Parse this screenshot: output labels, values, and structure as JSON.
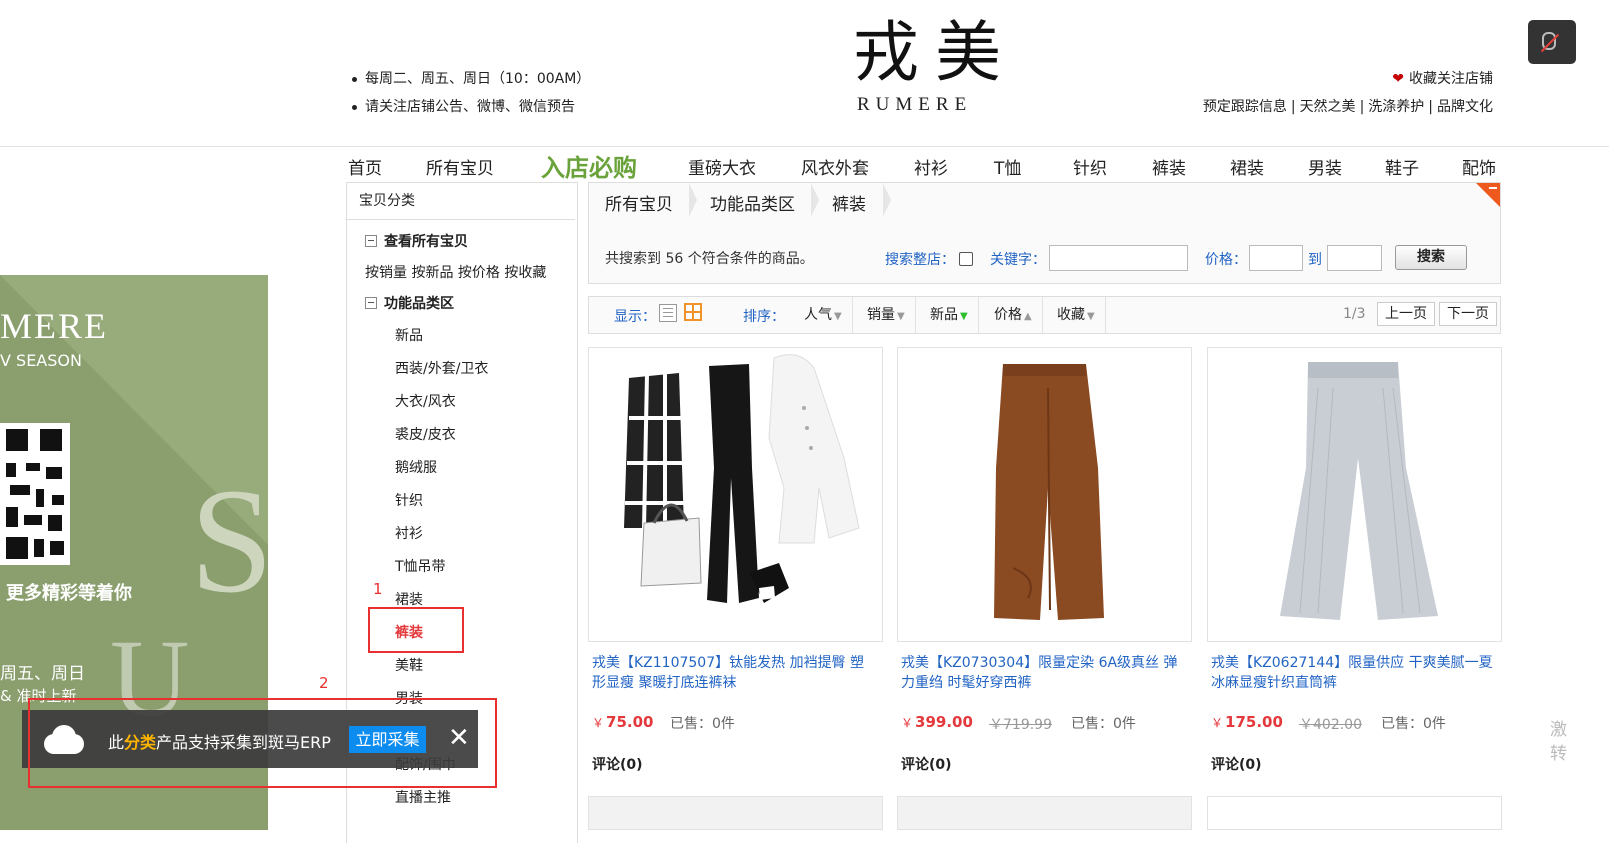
{
  "header": {
    "logo_cn": "戎美",
    "logo_en": "RUMERE",
    "notices": [
      "每周二、周五、周日（10：00AM）",
      "请关注店铺公告、微博、微信预告"
    ],
    "favorite": "收藏关注店铺",
    "links": [
      "预定跟踪信息",
      "天然之美",
      "洗涤养护",
      "品牌文化"
    ],
    "link_separator": "|"
  },
  "nav": {
    "items": [
      "首页",
      "所有宝贝",
      "入店必购",
      "重磅大衣",
      "风衣外套",
      "衬衫",
      "T恤",
      "针织",
      "裤装",
      "裙装",
      "男装",
      "鞋子",
      "配饰"
    ]
  },
  "sidebar": {
    "title": "宝贝分类",
    "view_all": "查看所有宝贝",
    "sort_links": [
      "按销量",
      "按新品",
      "按价格",
      "按收藏"
    ],
    "group": "功能品类区",
    "sub_items": [
      "新品",
      "西装/外套/卫衣",
      "大衣/风衣",
      "裘皮/皮衣",
      "鹅绒服",
      "针织",
      "衬衫",
      "T恤吊带",
      "裙装",
      "裤装",
      "美鞋",
      "男装",
      "配饰/围巾",
      "直播主推"
    ],
    "active_item": "裤装"
  },
  "annotations": {
    "label_1": "1",
    "label_2": "2"
  },
  "banner": {
    "brand": "MERE",
    "season": "V SEASON",
    "more": "更多精彩等着你",
    "days": "周五、周日",
    "ontime": "& 准时上新"
  },
  "collect_bar": {
    "text_pre": "此",
    "text_kw": "分类",
    "text_post": "产品支持采集到斑马ERP",
    "button": "立即采集",
    "close": "✕"
  },
  "breadcrumb": [
    "所有宝贝",
    "功能品类区",
    "裤装"
  ],
  "search": {
    "result_text": "共搜索到 56 个符合条件的商品。",
    "whole_shop_label": "搜索整店：",
    "whole_shop_checked": false,
    "keyword_label": "关键字：",
    "keyword_value": "",
    "price_label": "价格：",
    "price_to": "到",
    "price_min": "",
    "price_max": "",
    "button": "搜索"
  },
  "sortbar": {
    "display_label": "显示：",
    "sort_label": "排序：",
    "sorts": [
      "人气",
      "销量",
      "新品",
      "价格",
      "收藏"
    ],
    "page_indicator": "1/3",
    "prev": "上一页",
    "next": "下一页"
  },
  "products": [
    {
      "title": "戎美【KZ1107507】钛能发热 加裆提臀 塑形显瘦 聚暖打底连裤袜",
      "currency": "￥",
      "price": "75.00",
      "original_price": "",
      "sold": "已售：0件",
      "comment": "评论(0)"
    },
    {
      "title": "戎美【KZ0730304】限量定染 6A级真丝 弹力重绉 时髦好穿西裤",
      "currency": "￥",
      "price": "399.00",
      "original_price": "￥719.99",
      "sold": "已售：0件",
      "comment": "评论(0)"
    },
    {
      "title": "戎美【KZ0627144】限量供应 干爽美腻一夏 冰麻显瘦针织直筒裤",
      "currency": "￥",
      "price": "175.00",
      "original_price": "￥402.00",
      "sold": "已售：0件",
      "comment": "评论(0)"
    }
  ],
  "edge_text": "激转",
  "colors": {
    "accent_red": "#e4393c",
    "link_blue": "#2264c4",
    "nav_highlight": "#6aa33b",
    "erp_button": "#0d8cf0",
    "banner_green": "#8a9e6e"
  }
}
